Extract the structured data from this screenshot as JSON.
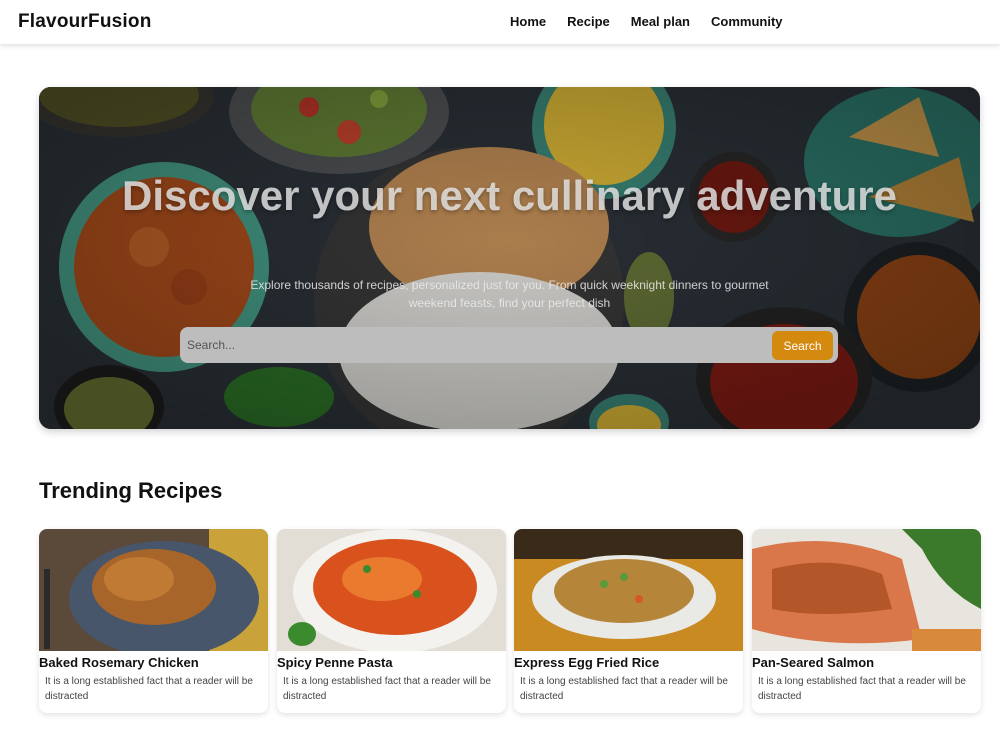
{
  "brand": {
    "name": "FlavourFusion"
  },
  "nav": {
    "items": [
      {
        "label": "Home"
      },
      {
        "label": "Recipe"
      },
      {
        "label": "Meal plan"
      },
      {
        "label": "Community"
      }
    ]
  },
  "hero": {
    "title": "Discover your next cullinary adventure",
    "subtitle": "Explore thousands of recipes, personalized just for you. From quick weeknight dinners to gourmet weekend feasts, find your perfect dish",
    "search": {
      "placeholder": "Search...",
      "value": "",
      "button_label": "Search"
    }
  },
  "trending": {
    "title": "Trending Recipes",
    "recipes": [
      {
        "title": "Baked Rosemary Chicken",
        "description": "It is a long established fact that a reader will be distracted"
      },
      {
        "title": "Spicy Penne Pasta",
        "description": "It is a long established fact that a reader will be distracted"
      },
      {
        "title": "Express Egg Fried Rice",
        "description": "It is a long established fact that a reader will be distracted"
      },
      {
        "title": "Pan-Seared Salmon",
        "description": "It is a long established fact that a reader will be distracted"
      }
    ]
  },
  "colors": {
    "accent": "#d4890f",
    "hero_bg": "#2b3036"
  }
}
